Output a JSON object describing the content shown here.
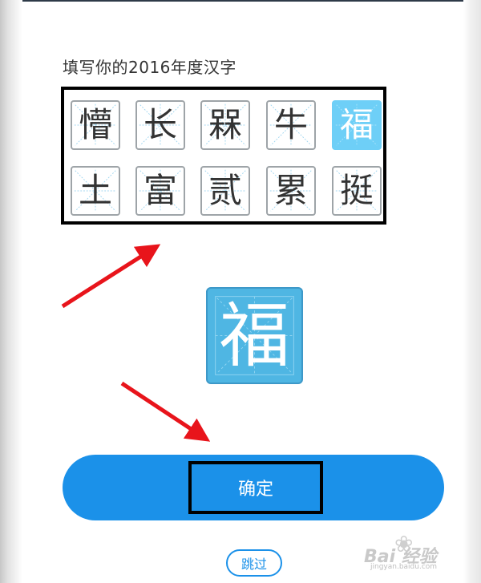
{
  "prompt": "填写你的2016年度汉字",
  "characters": [
    [
      "懵",
      "长",
      "槑",
      "牛",
      "福"
    ],
    [
      "土",
      "富",
      "贰",
      "累",
      "挺"
    ]
  ],
  "selected_character": "福",
  "preview_character": "福",
  "confirm_label": "确定",
  "skip_label": "跳过",
  "watermark": {
    "brand": "Bai  经验",
    "site": "jingyan.baidu.com"
  },
  "colors": {
    "accent": "#1b91e9",
    "selected_tile": "#6ecff7",
    "preview_tile": "#4fb6e3",
    "annotation_arrow": "#e8141b"
  }
}
